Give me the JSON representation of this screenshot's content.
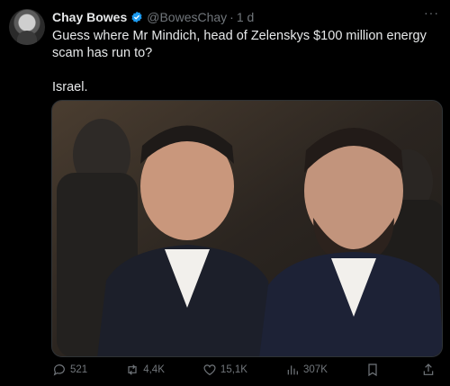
{
  "tweet": {
    "author_name": "Chay Bowes",
    "handle": "@BowesChay",
    "separator": "·",
    "time": "1 d",
    "more": "···",
    "text_line1": "Guess where Mr Mindich, head of Zelenskys $100 million energy scam has run to?",
    "text_line2": "Israel.",
    "image_description": "photo-two-men-in-suits",
    "verified_color": "#1d9bf0"
  },
  "actions": {
    "replies": "521",
    "reposts": "4,4K",
    "likes": "15,1K",
    "views": "307K"
  }
}
